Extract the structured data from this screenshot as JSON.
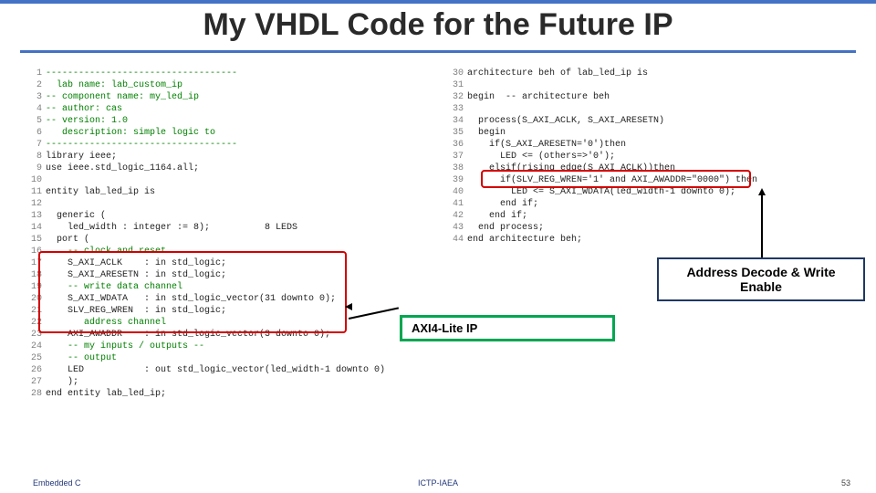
{
  "title": "My VHDL Code for the Future IP",
  "callouts": {
    "address_decode": "Address Decode & Write Enable",
    "axi_lite": "AXI4-Lite IP"
  },
  "footer": {
    "left": "Embedded C",
    "center": "ICTP-IAEA",
    "right": "53"
  },
  "code_left": [
    {
      "n": "1",
      "t": "-----------------------------------",
      "cls": "c-comment"
    },
    {
      "n": "2",
      "t": "  lab name: lab_custom_ip",
      "cls": "c-comment"
    },
    {
      "n": "3",
      "t": "-- component name: my_led_ip",
      "cls": "c-comment"
    },
    {
      "n": "4",
      "t": "-- author: cas",
      "cls": "c-comment"
    },
    {
      "n": "5",
      "t": "-- version: 1.0",
      "cls": "c-comment"
    },
    {
      "n": "6",
      "t": "   description: simple logic to",
      "cls": "c-comment"
    },
    {
      "n": "7",
      "t": "-----------------------------------",
      "cls": "c-comment"
    },
    {
      "n": "8",
      "t": "library ieee;",
      "cls": ""
    },
    {
      "n": "9",
      "t": "use ieee.std_logic_1164.all;",
      "cls": ""
    },
    {
      "n": "10",
      "t": "",
      "cls": ""
    },
    {
      "n": "11",
      "t": "entity lab_led_ip is",
      "cls": ""
    },
    {
      "n": "12",
      "t": "",
      "cls": ""
    },
    {
      "n": "13",
      "t": "  generic (",
      "cls": ""
    },
    {
      "n": "14",
      "t": "    led_width : integer := 8);          8 LEDS",
      "cls": ""
    },
    {
      "n": "15",
      "t": "  port (",
      "cls": ""
    },
    {
      "n": "16",
      "t": "    -- clock and reset",
      "cls": "c-comment"
    },
    {
      "n": "17",
      "t": "    S_AXI_ACLK    : in std_logic;",
      "cls": ""
    },
    {
      "n": "18",
      "t": "    S_AXI_ARESETN : in std_logic;",
      "cls": ""
    },
    {
      "n": "19",
      "t": "    -- write data channel",
      "cls": "c-comment"
    },
    {
      "n": "20",
      "t": "    S_AXI_WDATA   : in std_logic_vector(31 downto 0);",
      "cls": ""
    },
    {
      "n": "21",
      "t": "    SLV_REG_WREN  : in std_logic;",
      "cls": ""
    },
    {
      "n": "22",
      "t": "       address channel",
      "cls": "c-comment"
    },
    {
      "n": "23",
      "t": "    AXI_AWADDR    : in std_logic_vector(3 downto 0);",
      "cls": ""
    },
    {
      "n": "24",
      "t": "    -- my inputs / outputs --",
      "cls": "c-comment"
    },
    {
      "n": "25",
      "t": "    -- output",
      "cls": "c-comment"
    },
    {
      "n": "26",
      "t": "    LED           : out std_logic_vector(led_width-1 downto 0)",
      "cls": ""
    },
    {
      "n": "27",
      "t": "    );",
      "cls": ""
    },
    {
      "n": "28",
      "t": "end entity lab_led_ip;",
      "cls": ""
    }
  ],
  "code_right": [
    {
      "n": "30",
      "t": "architecture beh of lab_led_ip is",
      "cls": ""
    },
    {
      "n": "31",
      "t": "",
      "cls": ""
    },
    {
      "n": "32",
      "t": "begin  -- architecture beh",
      "cls": ""
    },
    {
      "n": "33",
      "t": "",
      "cls": ""
    },
    {
      "n": "34",
      "t": "  process(S_AXI_ACLK, S_AXI_ARESETN)",
      "cls": ""
    },
    {
      "n": "35",
      "t": "  begin",
      "cls": ""
    },
    {
      "n": "36",
      "t": "    if(S_AXI_ARESETN='0')then",
      "cls": ""
    },
    {
      "n": "37",
      "t": "      LED <= (others=>'0');",
      "cls": ""
    },
    {
      "n": "38",
      "t": "    elsif(rising_edge(S_AXI_ACLK))then",
      "cls": ""
    },
    {
      "n": "39",
      "t": "      if(SLV_REG_WREN='1' and AXI_AWADDR=\"0000\") then",
      "cls": ""
    },
    {
      "n": "40",
      "t": "        LED <= S_AXI_WDATA(led_width-1 downto 0);",
      "cls": ""
    },
    {
      "n": "41",
      "t": "      end if;",
      "cls": ""
    },
    {
      "n": "42",
      "t": "    end if;",
      "cls": ""
    },
    {
      "n": "43",
      "t": "  end process;",
      "cls": ""
    },
    {
      "n": "44",
      "t": "end architecture beh;",
      "cls": ""
    }
  ]
}
